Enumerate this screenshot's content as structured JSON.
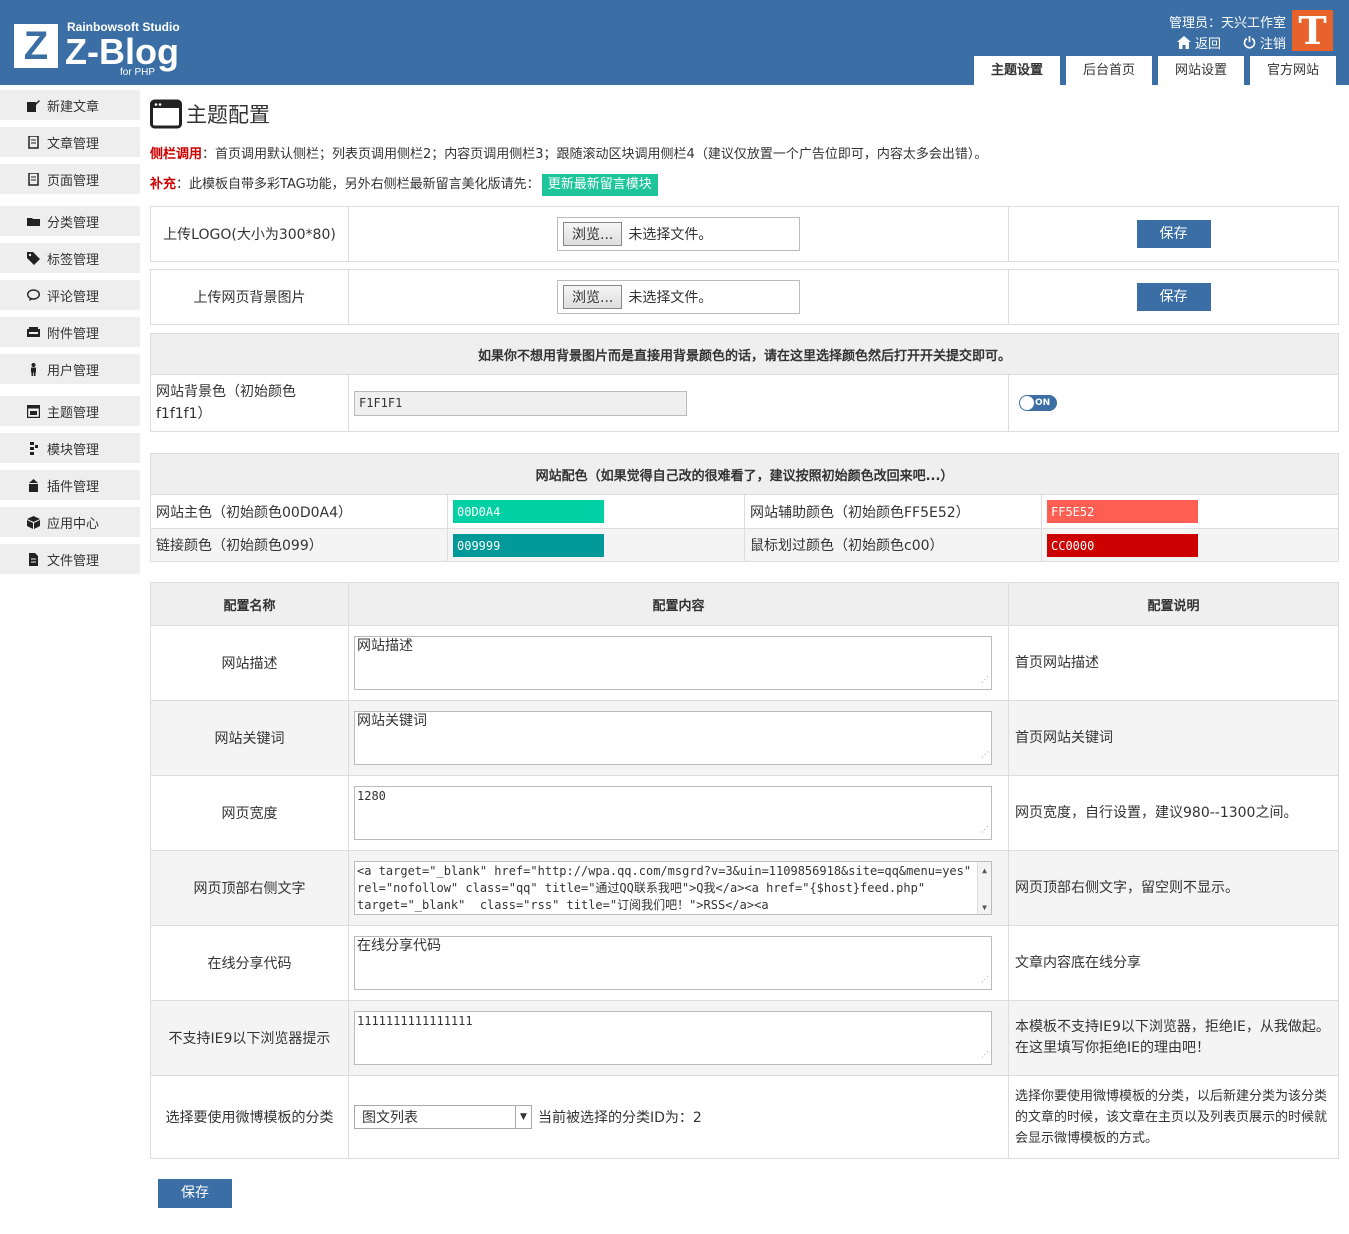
{
  "header": {
    "logo_letter": "Z",
    "logo_studio": "Rainbowsoft Studio",
    "logo_name": "Z-Blog",
    "logo_sub": "for PHP",
    "user_line": "管理员：天兴工作室",
    "back_label": "返回",
    "logout_label": "注销",
    "avatar_letter": "T",
    "tabs": [
      {
        "label": "主题设置"
      },
      {
        "label": "后台首页"
      },
      {
        "label": "网站设置"
      },
      {
        "label": "官方网站"
      }
    ]
  },
  "sidebar": {
    "items": [
      {
        "label": "新建文章",
        "icon": "edit-icon"
      },
      {
        "label": "文章管理",
        "icon": "document-icon"
      },
      {
        "label": "页面管理",
        "icon": "page-icon"
      },
      {
        "label": "分类管理",
        "icon": "folder-icon"
      },
      {
        "label": "标签管理",
        "icon": "tag-icon"
      },
      {
        "label": "评论管理",
        "icon": "comment-icon"
      },
      {
        "label": "附件管理",
        "icon": "attachment-icon"
      },
      {
        "label": "用户管理",
        "icon": "user-icon"
      },
      {
        "label": "主题管理",
        "icon": "theme-icon"
      },
      {
        "label": "模块管理",
        "icon": "module-icon"
      },
      {
        "label": "插件管理",
        "icon": "plugin-icon"
      },
      {
        "label": "应用中心",
        "icon": "app-center-icon"
      },
      {
        "label": "文件管理",
        "icon": "file-icon"
      }
    ]
  },
  "main": {
    "title": "主题配置",
    "notice1_label": "侧栏调用",
    "notice1_text": "：首页调用默认侧栏；列表页调用侧栏2；内容页调用侧栏3；跟随滚动区块调用侧栏4（建议仅放置一个广告位即可，内容太多会出错）。",
    "notice2_label": "补充",
    "notice2_text": "：此模板自带多彩TAG功能，另外右侧栏最新留言美化版请先：",
    "notice2_button": "更新最新留言模块",
    "upload_logo_label": "上传LOGO(大小为300*80)",
    "upload_bg_label": "上传网页背景图片",
    "browse_label": "浏览...",
    "no_file_label": "未选择文件。",
    "save_label": "保存",
    "bg_head": "如果你不想用背景图片而是直接用背景颜色的话，请在这里选择颜色然后打开开关提交即可。",
    "bg_color_label": "网站背景色（初始颜色f1f1f1）",
    "bg_color_value": "F1F1F1",
    "toggle_label": "ON",
    "color_head": "网站配色（如果觉得自己改的很难看了，建议按照初始颜色改回来吧...）",
    "colors": {
      "main_label": "网站主色（初始颜色00D0A4）",
      "main_value": "00D0A4",
      "main_hex": "#00D0A4",
      "aux_label": "网站辅助颜色（初始颜色FF5E52）",
      "aux_value": "FF5E52",
      "aux_hex": "#FF5E52",
      "link_label": "链接颜色（初始颜色099）",
      "link_value": "009999",
      "link_hex": "#009999",
      "hover_label": "鼠标划过颜色（初始颜色c00）",
      "hover_value": "CC0000",
      "hover_hex": "#CC0000"
    },
    "cfg_head": {
      "name": "配置名称",
      "content": "配置内容",
      "desc": "配置说明"
    },
    "cfg_rows": [
      {
        "name": "网站描述",
        "value": "网站描述",
        "desc": "首页网站描述"
      },
      {
        "name": "网站关键词",
        "value": "网站关键词",
        "desc": "首页网站关键词"
      },
      {
        "name": "网页宽度",
        "value": "1280",
        "desc": "网页宽度，自行设置，建议980--1300之间。"
      },
      {
        "name": "网页顶部右侧文字",
        "value": "<a target=\"_blank\" href=\"http://wpa.qq.com/msgrd?v=3&uin=1109856918&site=qq&menu=yes\" rel=\"nofollow\" class=\"qq\" title=\"通过QQ联系我吧\">Q我</a><a href=\"{$host}feed.php\" target=\"_blank\"  class=\"rss\" title=\"订阅我们吧！\">RSS</a><a",
        "desc": "网页顶部右侧文字，留空则不显示。"
      },
      {
        "name": "在线分享代码",
        "value": "在线分享代码",
        "desc": "文章内容底在线分享"
      },
      {
        "name": "不支持IE9以下浏览器提示",
        "value": "1111111111111111",
        "desc": "本模板不支持IE9以下浏览器，拒绝IE，从我做起。在这里填写你拒绝IE的理由吧！"
      },
      {
        "name": "选择要使用微博模板的分类",
        "value": "图文列表",
        "current": "当前被选择的分类ID为：2",
        "desc": "选择你要使用微博模板的分类，以后新建分类为该分类的文章的时候，该文章在主页以及列表页展示的时候就会显示微博模板的方式。"
      }
    ]
  }
}
